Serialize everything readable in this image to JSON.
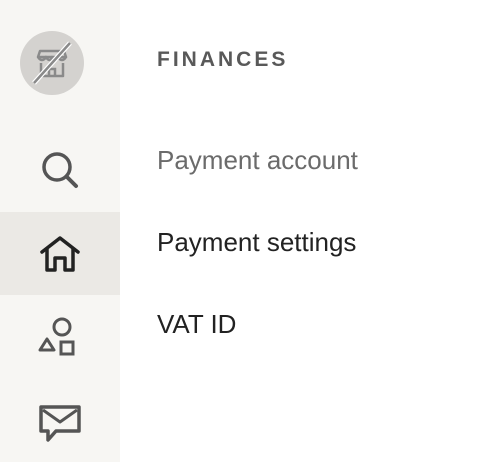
{
  "nav_rail": {
    "items": [
      {
        "icon": "search-icon",
        "active": false
      },
      {
        "icon": "home-icon",
        "active": true
      },
      {
        "icon": "shapes-icon",
        "active": false
      },
      {
        "icon": "message-icon",
        "active": false
      }
    ]
  },
  "section": {
    "title": "FINANCES",
    "items": [
      {
        "label": "Payment account"
      },
      {
        "label": "Payment settings"
      },
      {
        "label": "VAT ID"
      }
    ]
  },
  "colors": {
    "rail_background": "#f7f6f3",
    "rail_active": "#ebe9e5",
    "avatar_background": "#d4d2cf",
    "text_primary": "#222222",
    "text_muted": "#6b6b6b"
  }
}
